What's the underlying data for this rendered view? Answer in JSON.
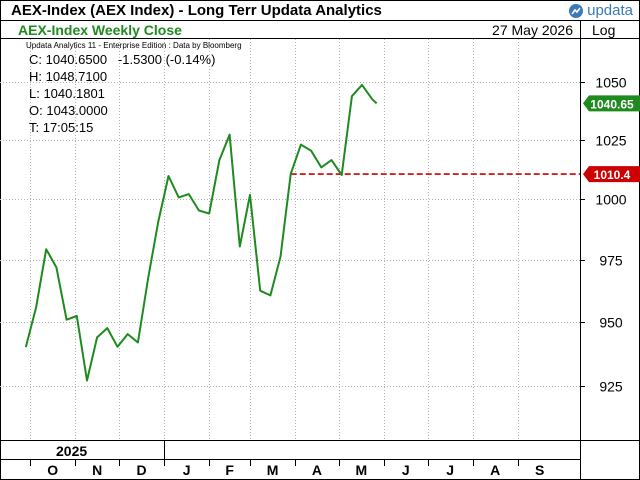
{
  "header": {
    "title": "AEX-Index (AEX Index) - Long Terr Updata Analytics",
    "brand": "updata"
  },
  "panel": {
    "series_title": "AEX-Index Weekly Close",
    "date": "27 May 2026",
    "scale_label": "Log",
    "source_line": "Updata Analytics 11 - Enterprise Edition : Data by Bloomberg"
  },
  "readout": {
    "close": "C: 1040.6500   -1.5300 (-0.14%)",
    "high": "H: 1048.7100",
    "low": "L: 1040.1801",
    "open": "O: 1043.0000",
    "time": "T: 17:05:15"
  },
  "colors": {
    "line": "#1f8a1f",
    "price_tag": "#1f8a1f",
    "level": "#cc0000",
    "grid": "#b4b4b4",
    "title_text": "#1f8a1f",
    "brand": "#3a7ab8"
  },
  "chart_data": {
    "type": "line",
    "scale": "log",
    "ylim": [
      905,
      1065
    ],
    "yticks": [
      925,
      950,
      975,
      1000,
      1025,
      1050
    ],
    "year_label": "2025",
    "month_labels": [
      "O",
      "N",
      "D",
      "J",
      "F",
      "M",
      "A",
      "M",
      "J",
      "J",
      "A",
      "S"
    ],
    "series": [
      {
        "x": [
          "2025-09-28",
          "2025-10-05",
          "2025-10-12",
          "2025-10-19",
          "2025-10-26",
          "2025-11-02",
          "2025-11-09",
          "2025-11-16",
          "2025-11-23",
          "2025-11-30",
          "2025-12-07",
          "2025-12-14",
          "2025-12-21",
          "2025-12-28",
          "2026-01-04",
          "2026-01-11",
          "2026-01-18",
          "2026-01-25",
          "2026-02-01",
          "2026-02-08",
          "2026-02-15",
          "2026-02-22",
          "2026-03-01",
          "2026-03-08",
          "2026-03-15",
          "2026-03-22",
          "2026-03-29",
          "2026-04-05",
          "2026-04-12",
          "2026-04-19",
          "2026-04-26",
          "2026-05-03",
          "2026-05-10",
          "2026-05-17",
          "2026-05-24",
          "2026-05-27"
        ],
        "y": [
          940.0,
          955.5,
          979.2,
          971.8,
          950.8,
          952.3,
          927.0,
          943.8,
          947.5,
          940.1,
          945.1,
          941.8,
          967.3,
          990.6,
          1009.6,
          1000.6,
          1002.0,
          995.1,
          993.9,
          1016.3,
          1027.2,
          980.3,
          1001.7,
          962.4,
          960.5,
          976.1,
          1010.4,
          1022.9,
          1020.3,
          1013.2,
          1016.3,
          1010.0,
          1043.8,
          1048.7,
          1042.5,
          1040.65
        ]
      }
    ],
    "level_line": {
      "value": 1010.4,
      "label": "1010.4"
    },
    "last_price_label": "1040.65"
  }
}
